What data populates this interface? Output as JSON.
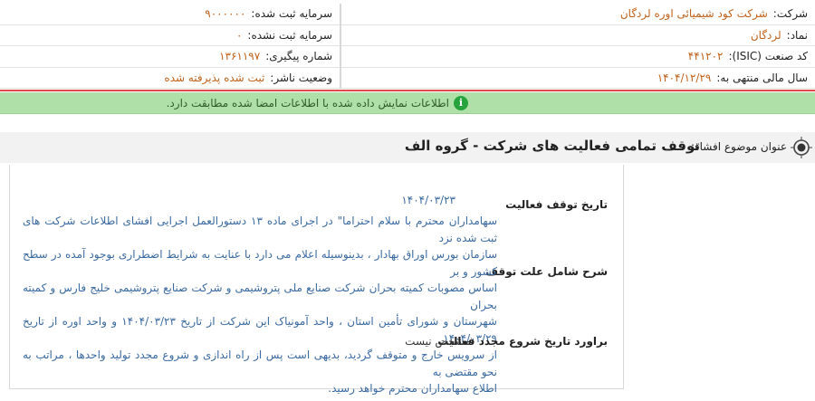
{
  "company_info": {
    "right_column": [
      {
        "label": "شرکت:",
        "value": "شرکت کود شیمیائی اوره لردگان"
      },
      {
        "label": "نماد:",
        "value": "لردگان"
      },
      {
        "label": "کد صنعت (ISIC):",
        "value": "۴۴۱۲۰۲"
      },
      {
        "label": "سال مالی منتهی به:",
        "value": "۱۴۰۴/۱۲/۲۹"
      }
    ],
    "left_column": [
      {
        "label": "سرمایه ثبت شده:",
        "value": "۹۰۰۰۰۰۰"
      },
      {
        "label": "سرمایه ثبت نشده:",
        "value": "۰"
      },
      {
        "label": "شماره پیگیری:",
        "value": "۱۳۶۱۱۹۷"
      },
      {
        "label": "وضعیت ناشر:",
        "value": "ثبت شده پذیرفته شده"
      }
    ]
  },
  "alert": {
    "message": "اطلاعات نمایش داده شده با اطلاعات امضا شده مطابقت دارد."
  },
  "subject": {
    "label": "عنوان موضوع افشاء:",
    "value": "توقف تمامی فعالیت های شرکت - گروه الف"
  },
  "details": {
    "stop_date_label": "تاریخ توقف فعالیت",
    "stop_date_value": "۱۴۰۴/۰۳/۲۳",
    "reason_label": "شرح شامل علت توقف",
    "reason_lines": [
      "سهامداران محترم با سلام احتراما\" در اجرای ماده ۱۳ دستورالعمل اجرایی افشای اطلاعات شرکت های ثبت شده نزد",
      "سازمان بورس اوراق بهادار ، بدینوسیله اعلام می دارد با عنایت به شرایط اضطراری بوجود آمده در سطح کشور و بر",
      "اساس مصوبات کمیته بحران شرکت صنایع ملی پتروشیمی و شرکت صنایع پتروشیمی خلیج فارس و کمیته بحران",
      "شهرستان و شورای تأمین استان ، واحد آمونیاک این شرکت از تاریخ ۱۴۰۴/۰۳/۲۳ و واحد اوره از تاریخ ۱۴۰۴/۰۳/۲۹",
      "از سرویس خارج و متوقف گردید، بدیهی است پس از راه اندازی و شروع مجدد تولید واحدها ، مراتب به نحو مقتضی به",
      "اطلاع سهامداران محترم خواهد رسید."
    ],
    "restart_label": "براورد تاریخ شروع مجدد فعالیت",
    "restart_value": "مشخص نیست"
  },
  "colors": {
    "value_orange": "#c0621b",
    "alert_green": "#aee0a8",
    "separator_red": "#e04a4a",
    "detail_blue": "#3a6aa0"
  },
  "icons": {
    "alert": "info-icon",
    "subject": "target-icon"
  }
}
